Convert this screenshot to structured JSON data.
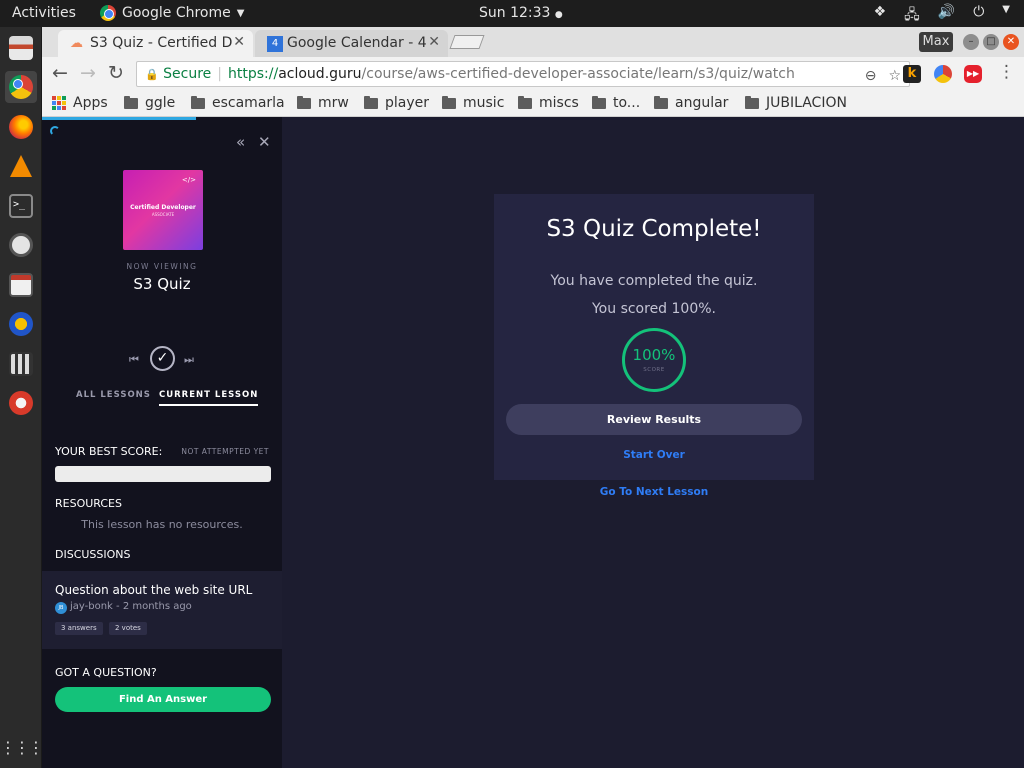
{
  "system_bar": {
    "activities": "Activities",
    "app_name": "Google Chrome",
    "clock": "Sun 12:33"
  },
  "tabs": [
    {
      "title": "S3 Quiz - Certified D"
    },
    {
      "title": "Google Calendar - 4"
    }
  ],
  "window": {
    "max_label": "Max"
  },
  "address_bar": {
    "secure_label": "Secure",
    "scheme": "https://",
    "host": "acloud.guru",
    "path": "/course/aws-certified-developer-associate/learn/s3/quiz/watch"
  },
  "bookmarks": {
    "apps": "Apps",
    "folders": [
      "ggle",
      "escamarla",
      "mrw",
      "player",
      "music",
      "miscs",
      "to...",
      "angular",
      "JUBILACION"
    ]
  },
  "sidebar": {
    "course_art_title": "Certified Developer",
    "course_art_sub": "ASSOCIATE",
    "course_art_tag": "</>",
    "now_viewing": "NOW VIEWING",
    "current_title": "S3 Quiz",
    "tab_all": "ALL LESSONS",
    "tab_current": "CURRENT LESSON",
    "best_score_label": "YOUR BEST SCORE:",
    "not_attempted": "NOT ATTEMPTED YET",
    "resources_label": "RESOURCES",
    "no_resources": "This lesson has no resources.",
    "discussions_label": "DISCUSSIONS",
    "discussion": {
      "title": "Question about the web site URL",
      "author_initials": "JB",
      "author": "jay-bonk",
      "time": "2 months ago",
      "meta": "jay-bonk - 2 months ago",
      "answers": "3 answers",
      "votes": "2 votes"
    },
    "question_label": "GOT A QUESTION?",
    "find_answer": "Find An Answer"
  },
  "quiz": {
    "title": "S3 Quiz Complete!",
    "completed_text": "You have completed the quiz.",
    "scored_text": "You scored 100%.",
    "score_value": "100%",
    "score_caption": "SCORE",
    "score_fraction": 1.0,
    "review_button": "Review Results",
    "start_over": "Start Over",
    "next_lesson": "Go To Next Lesson"
  },
  "colors": {
    "page_background": "#1c1c2f",
    "sidebar_background": "#12121e",
    "card_background": "#252541",
    "accent_green": "#14c27a",
    "link_blue": "#2f7df6",
    "loading_blue": "#2fa8e2"
  },
  "icons": {
    "dock": [
      "files-icon",
      "chrome-icon",
      "firefox-icon",
      "vlc-icon",
      "terminal-icon",
      "software-updater-icon",
      "archive-icon",
      "headphones-icon",
      "video-editor-icon",
      "settings-tool-icon",
      "show-apps-icon"
    ],
    "tray": [
      "dropbox-icon",
      "network-icon",
      "volume-icon",
      "power-icon",
      "menu-arrow-icon"
    ]
  }
}
